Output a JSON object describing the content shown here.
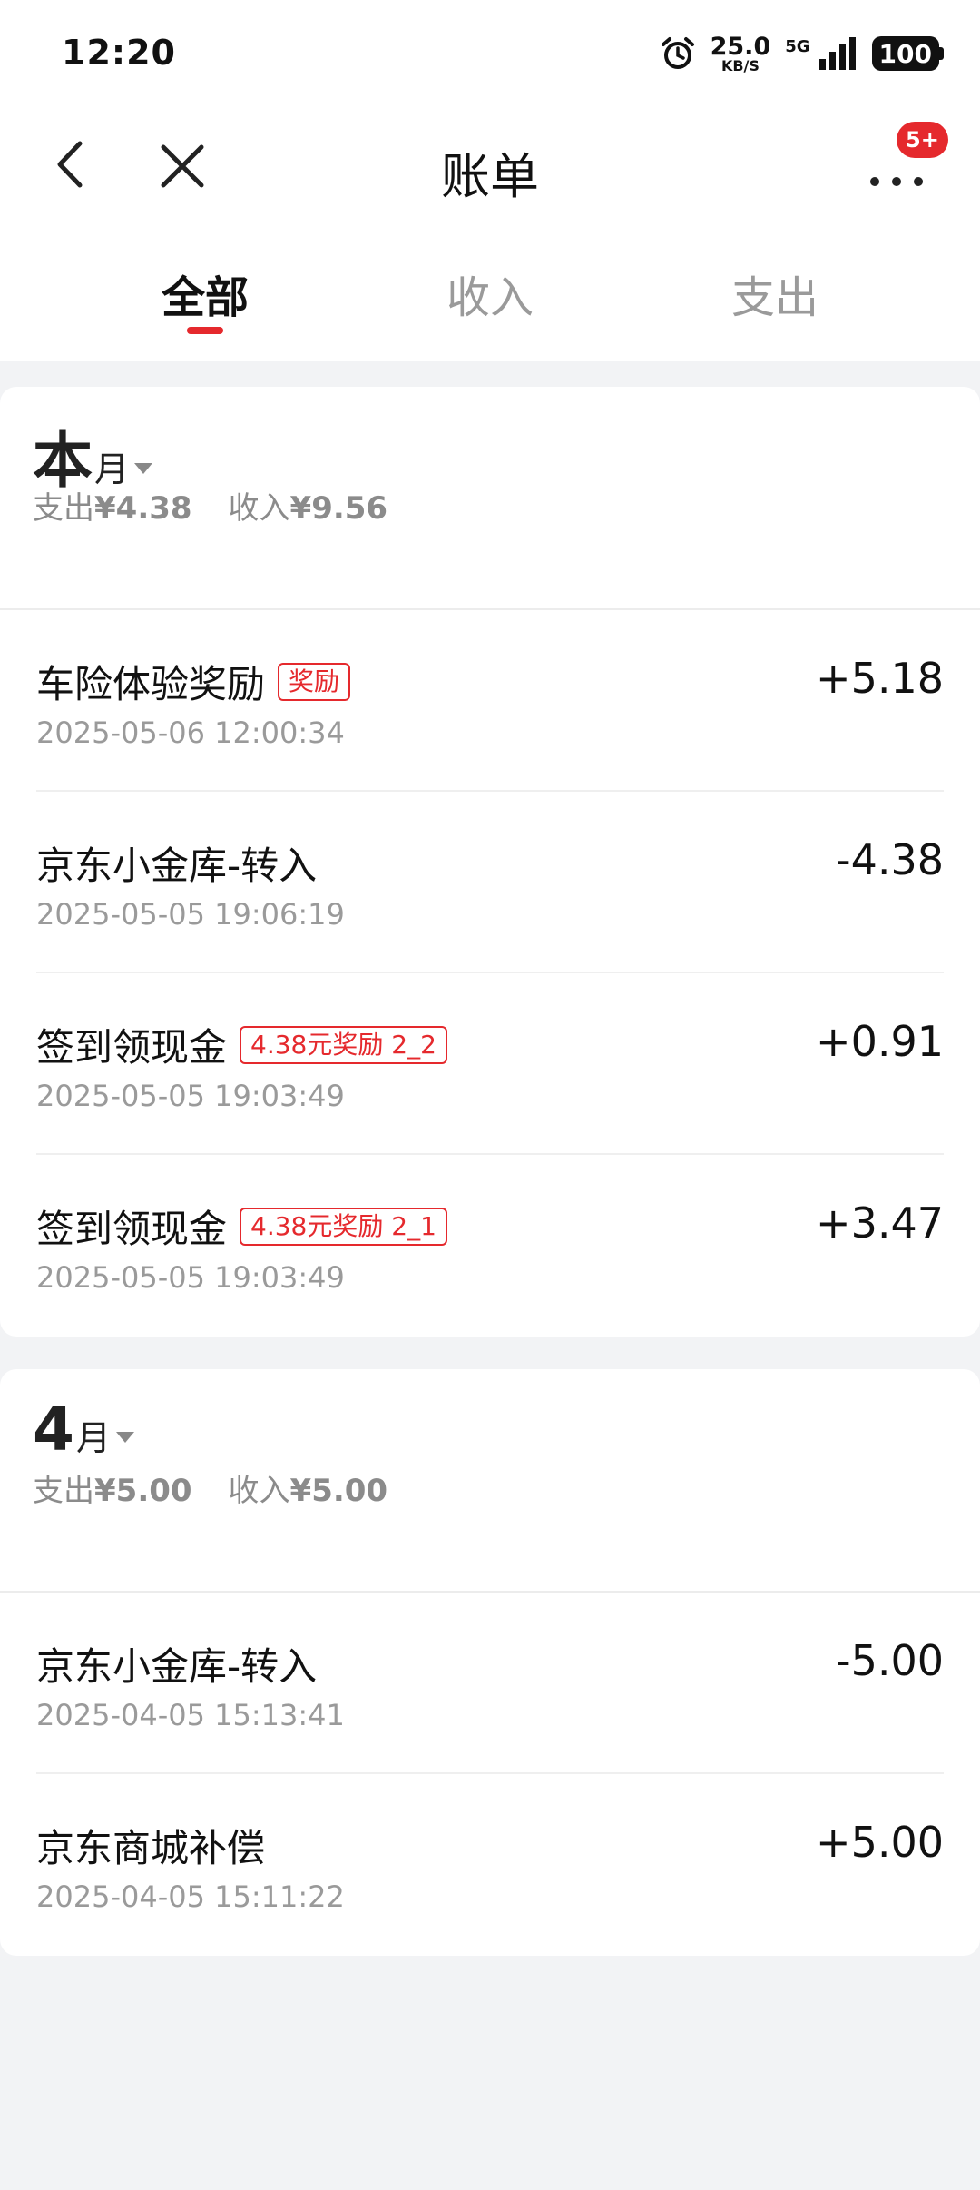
{
  "status_bar": {
    "time": "12:20",
    "speed_value": "25.0",
    "speed_unit": "KB/S",
    "network": "5G",
    "battery": "100",
    "icons": [
      "alarm-icon",
      "signal-icon",
      "battery-icon"
    ]
  },
  "nav": {
    "title": "账单",
    "badge": "5+",
    "icons": [
      "back-icon",
      "close-icon",
      "more-icon"
    ]
  },
  "tabs": [
    {
      "label": "全部",
      "active": true
    },
    {
      "label": "收入",
      "active": false
    },
    {
      "label": "支出",
      "active": false
    }
  ],
  "sections": [
    {
      "month_big": "本",
      "month_small": "月",
      "expense_label": "支出",
      "expense_value": "¥4.38",
      "income_label": "收入",
      "income_value": "¥9.56",
      "items": [
        {
          "title": "车险体验奖励",
          "tag": "奖励",
          "date": "2025-05-06 12:00:34",
          "amount": "+5.18"
        },
        {
          "title": "京东小金库-转入",
          "tag": "",
          "date": "2025-05-05 19:06:19",
          "amount": "-4.38"
        },
        {
          "title": "签到领现金",
          "tag": "4.38元奖励 2_2",
          "date": "2025-05-05 19:03:49",
          "amount": "+0.91"
        },
        {
          "title": "签到领现金",
          "tag": "4.38元奖励 2_1",
          "date": "2025-05-05 19:03:49",
          "amount": "+3.47"
        }
      ]
    },
    {
      "month_big": "4",
      "month_small": "月",
      "expense_label": "支出",
      "expense_value": "¥5.00",
      "income_label": "收入",
      "income_value": "¥5.00",
      "items": [
        {
          "title": "京东小金库-转入",
          "tag": "",
          "date": "2025-04-05 15:13:41",
          "amount": "-5.00"
        },
        {
          "title": "京东商城补偿",
          "tag": "",
          "date": "2025-04-05 15:11:22",
          "amount": "+5.00"
        }
      ]
    }
  ],
  "colors": {
    "accent": "#e5292d",
    "muted": "#9a9a9a",
    "background": "#f2f3f5"
  }
}
